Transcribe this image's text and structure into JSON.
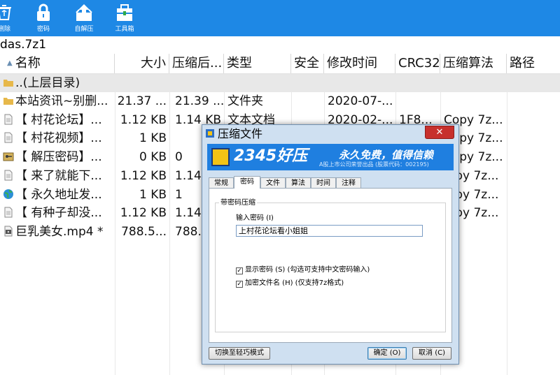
{
  "toolbar": {
    "items": [
      {
        "label": "删除",
        "icon": "recycle-bin-icon"
      },
      {
        "label": "密码",
        "icon": "lock-icon"
      },
      {
        "label": "自解压",
        "icon": "self-extract-icon"
      },
      {
        "label": "工具箱",
        "icon": "toolbox-icon"
      }
    ]
  },
  "path": "das.7z1",
  "columns": [
    "名称",
    "大小",
    "压缩后...",
    "类型",
    "安全",
    "修改时间",
    "CRC32",
    "压缩算法",
    "路径"
  ],
  "parent_row": "..(上层目录)",
  "files": [
    {
      "name": "本站资讯~别删...",
      "size": "21.37 ...",
      "packed": "21.39 ...",
      "type": "文件夹",
      "time": "2020-07-...",
      "crc": "",
      "method": "",
      "icon": "folder-icon"
    },
    {
      "name": "【 村花论坛】...",
      "size": "1.12 KB",
      "packed": "1.14 KB",
      "type": "文本文档",
      "time": "2020-02-...",
      "crc": "1F8...",
      "method": "Copy 7z...",
      "icon": "text-file-icon"
    },
    {
      "name": "【 村花视频】...",
      "size": "1 KB",
      "packed": "",
      "type": "",
      "time": "",
      "crc": "",
      "method": "Copy 7z...",
      "icon": "text-file-icon"
    },
    {
      "name": "【 解压密码】...",
      "size": "0 KB",
      "packed": "0",
      "type": "",
      "time": "",
      "crc": "",
      "method": "Copy 7z...",
      "icon": "key-file-icon"
    },
    {
      "name": "【 来了就能下...",
      "size": "1.12 KB",
      "packed": "1.14",
      "type": "",
      "time": "",
      "crc": "",
      "method": "...py 7z...",
      "icon": "text-file-icon"
    },
    {
      "name": "【 永久地址发...",
      "size": "1 KB",
      "packed": "1",
      "type": "",
      "time": "",
      "crc": "",
      "method": "...py 7z...",
      "icon": "globe-icon"
    },
    {
      "name": "【 有种子却没...",
      "size": "1.12 KB",
      "packed": "1.14",
      "type": "",
      "time": "",
      "crc": "",
      "method": "...py 7z...",
      "icon": "text-file-icon"
    },
    {
      "name": "巨乳美女.mp4 *",
      "size": "788.5...",
      "packed": "788.",
      "type": "",
      "time": "",
      "crc": "",
      "method": "",
      "icon": "video-file-icon"
    }
  ],
  "dialog": {
    "title": "压缩文件",
    "close_glyph": "✕",
    "banner": {
      "brand": "2345好压",
      "slogan": "永久免费，值得信赖",
      "sub": "A股上市公司荣誉出品 (股票代码：002195)"
    },
    "tabs": [
      "常规",
      "密码",
      "文件",
      "算法",
      "时间",
      "注释"
    ],
    "active_tab": 1,
    "group_title": "带密码压缩",
    "password_label": "输入密码 (I)",
    "password_value": "上村花论坛看小姐姐",
    "show_password": {
      "label": "显示密码 (S)  (勾选可支持中文密码输入)",
      "checked": true
    },
    "encrypt_names": {
      "label": "加密文件名 (H)  (仅支持7z格式)",
      "checked": true
    },
    "buttons": {
      "simple_mode": "切换至轻巧模式",
      "ok": "确定 (O)",
      "cancel": "取消 (C)"
    }
  },
  "colors": {
    "toolbar": "#1e88e5",
    "banner": "#1f7fe0",
    "close": "#c7302c"
  }
}
